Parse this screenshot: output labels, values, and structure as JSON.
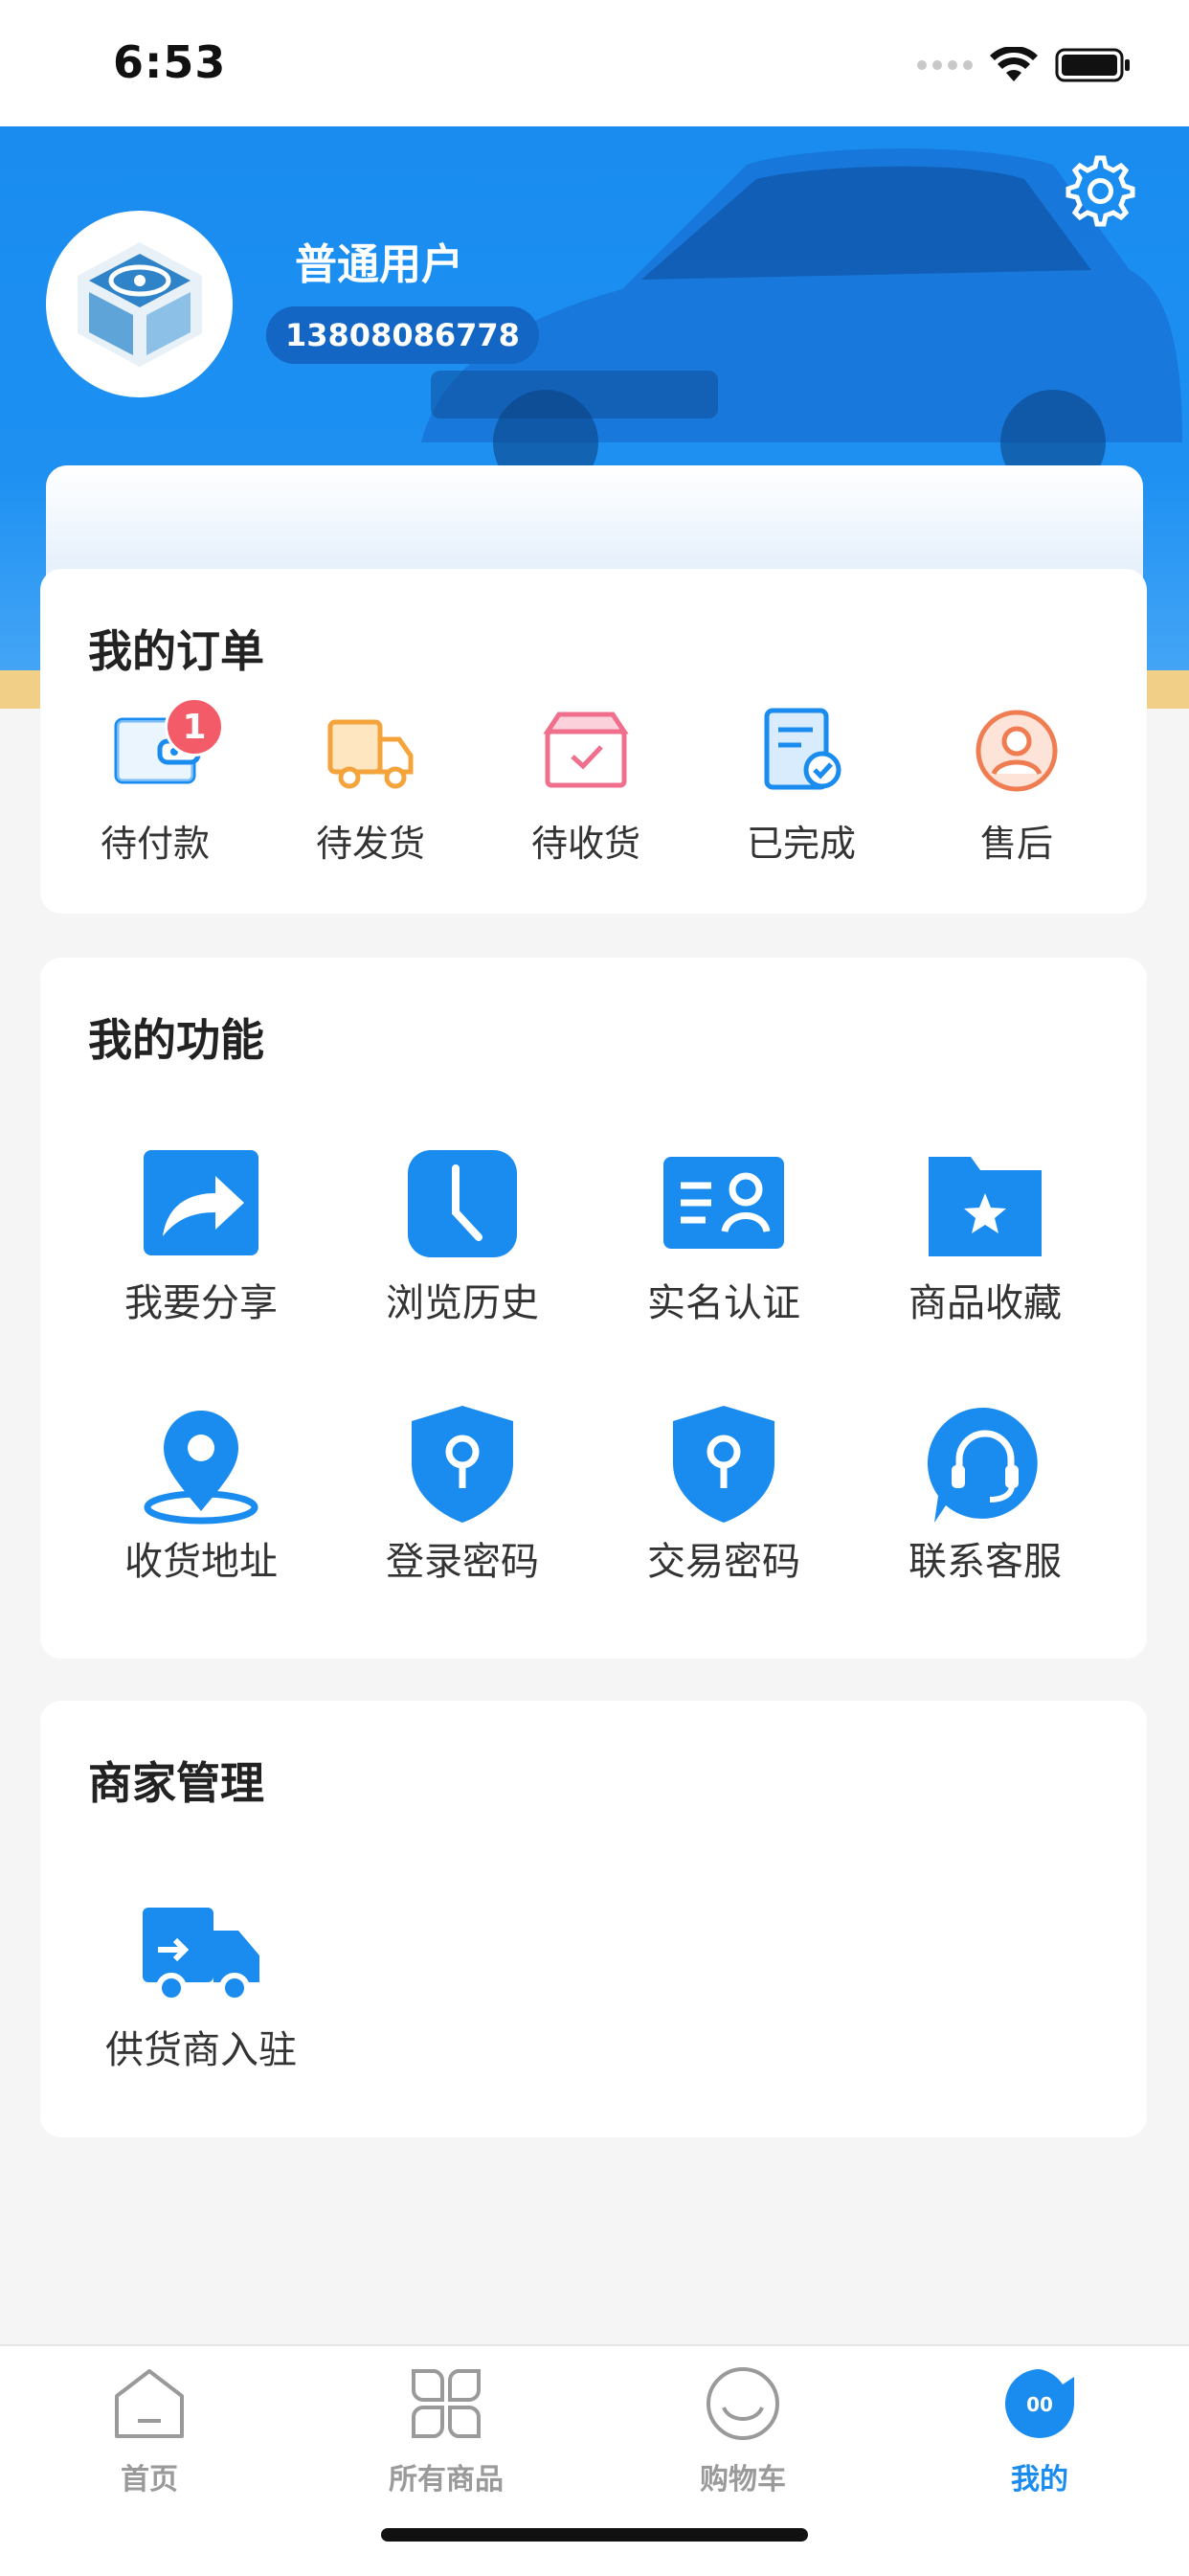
{
  "status_bar": {
    "time": "6:53"
  },
  "profile": {
    "username": "普通用户",
    "phone": "13808086778"
  },
  "orders": {
    "title": "我的订单",
    "items": [
      {
        "label": "待付款",
        "badge": "1",
        "icon": "wallet-icon"
      },
      {
        "label": "待发货",
        "icon": "truck-icon"
      },
      {
        "label": "待收货",
        "icon": "package-icon"
      },
      {
        "label": "已完成",
        "icon": "completed-document-icon"
      },
      {
        "label": "售后",
        "icon": "after-sales-icon"
      }
    ]
  },
  "functions": {
    "title": "我的功能",
    "items": [
      {
        "label": "我要分享",
        "icon": "share-icon"
      },
      {
        "label": "浏览历史",
        "icon": "clock-icon"
      },
      {
        "label": "实名认证",
        "icon": "id-card-icon"
      },
      {
        "label": "商品收藏",
        "icon": "star-folder-icon"
      },
      {
        "label": "收货地址",
        "icon": "location-pin-icon"
      },
      {
        "label": "登录密码",
        "icon": "shield-key-icon"
      },
      {
        "label": "交易密码",
        "icon": "shield-key-icon"
      },
      {
        "label": "联系客服",
        "icon": "headset-icon"
      }
    ]
  },
  "merchant": {
    "title": "商家管理",
    "items": [
      {
        "label": "供货商入驻",
        "icon": "delivery-truck-icon"
      }
    ]
  },
  "tabbar": {
    "tabs": [
      {
        "label": "首页",
        "icon": "home-icon"
      },
      {
        "label": "所有商品",
        "icon": "grid-icon"
      },
      {
        "label": "购物车",
        "icon": "cart-icon"
      },
      {
        "label": "我的",
        "icon": "profile-icon",
        "active": true,
        "icon_text": "00"
      }
    ]
  },
  "colors": {
    "primary": "#1a8cf0",
    "badge": "#f25b67",
    "gold": "#f2cf86"
  }
}
